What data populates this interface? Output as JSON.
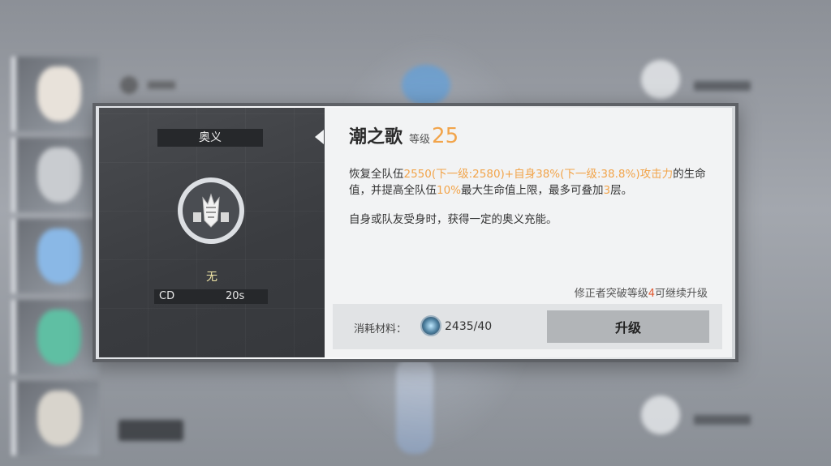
{
  "skill_panel": {
    "category": "奥义",
    "type": "无",
    "cd_label": "CD",
    "cd_value": "20s",
    "icon": "skill-emblem-icon"
  },
  "skill_detail": {
    "name": "潮之歌",
    "level_label": "等级",
    "level": "25",
    "description": {
      "p1": "恢复全队伍",
      "p2": "2550(下一级:2580)+自身38%(下一级:38.8%)攻击力",
      "p3": "的生命值，并提高全队伍",
      "p4": "10%",
      "p5": "最大生命值上限，最多可叠加",
      "p6": "3",
      "p7": "层。"
    },
    "description2": "自身或队友受身时，获得一定的奥义充能。",
    "upgrade_note_prefix": "修正者突破等级",
    "upgrade_note_num": "4",
    "upgrade_note_suffix": "可继续升级",
    "cost_label": "消耗材料：",
    "cost_value": "2435/40",
    "cost_icon": "material-crystal-icon",
    "upgrade_button": "升级"
  },
  "colors": {
    "accent": "#f2a44a",
    "warning": "#e05a32"
  }
}
